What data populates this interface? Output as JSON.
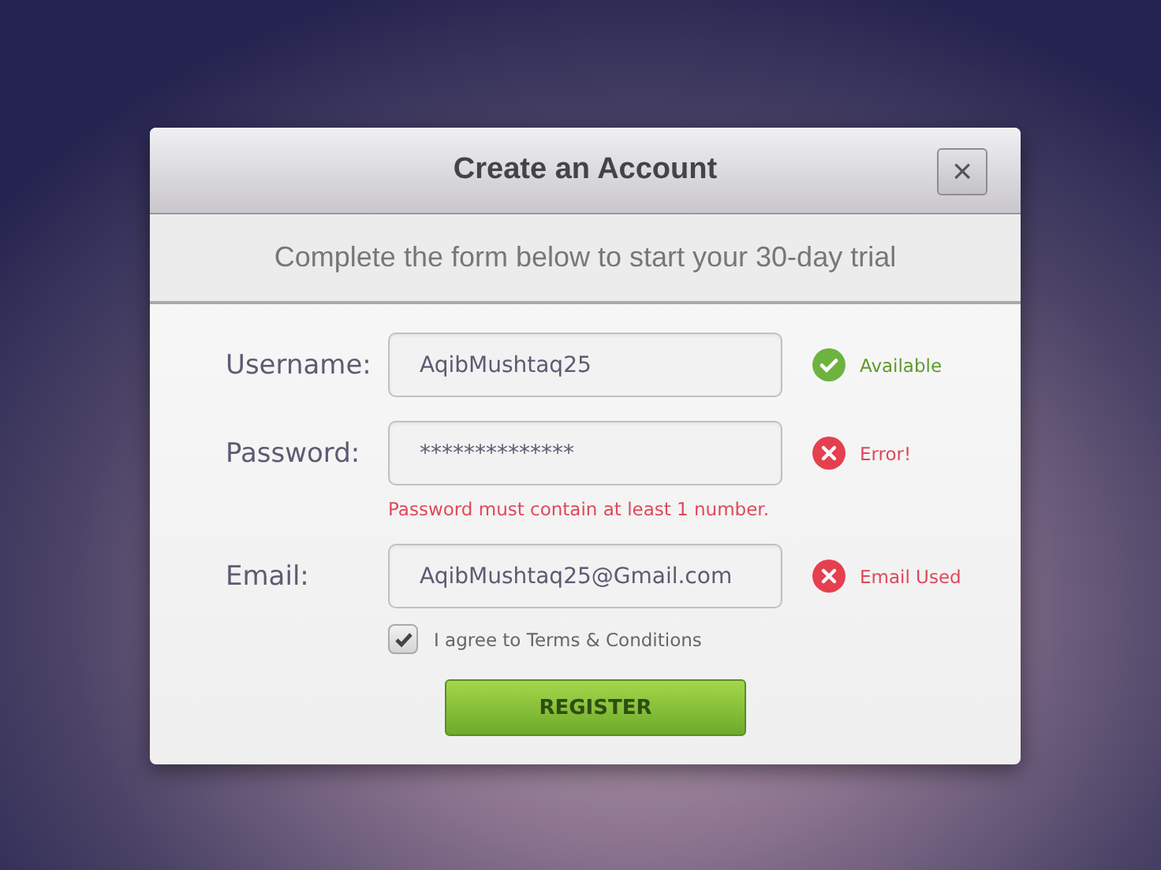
{
  "dialog": {
    "title": "Create an Account",
    "close": "×",
    "subtitle": "Complete the form below to start your 30-day trial"
  },
  "fields": [
    {
      "label": "Username:",
      "value": "AqibMushtaq25",
      "status": {
        "kind": "ok",
        "text": "Available"
      }
    },
    {
      "label": "Password:",
      "value": "**************",
      "status": {
        "kind": "error",
        "text": "Error!"
      },
      "error": "Password must contain at least 1 number."
    },
    {
      "label": "Email:",
      "value": "AqibMushtaq25@Gmail.com",
      "status": {
        "kind": "error",
        "text": "Email Used"
      }
    }
  ],
  "terms": {
    "label": "I agree to Terms & Conditions",
    "checked": true
  },
  "submit": "REGISTER"
}
